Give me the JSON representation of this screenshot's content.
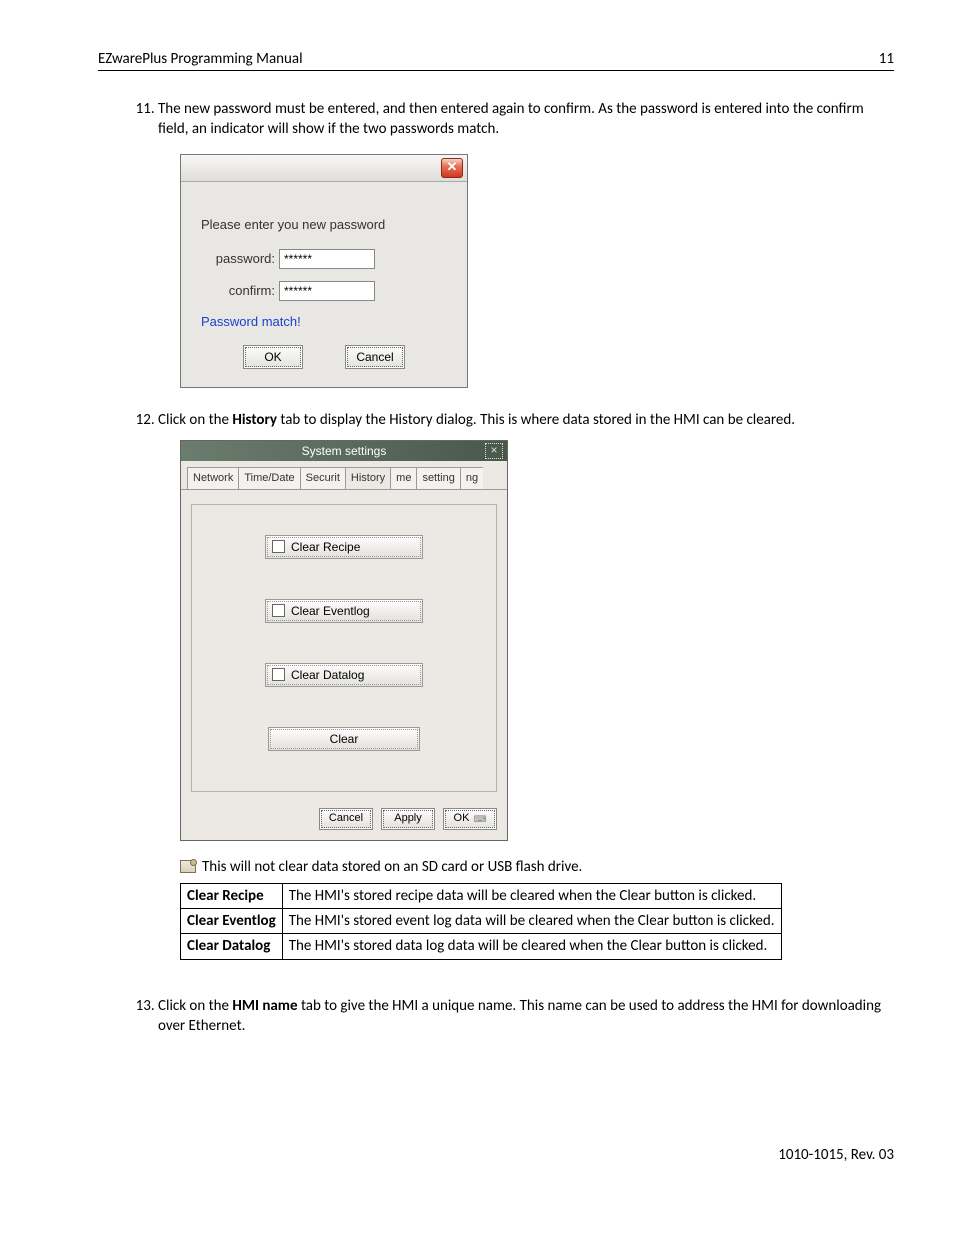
{
  "header": {
    "title": "EZwarePlus Programming Manual",
    "page": "11"
  },
  "item11": {
    "num": "11.",
    "text": "The new password must be entered, and then entered again to confirm. As the password is entered into the confirm field, an indicator will show if the two passwords match."
  },
  "pwdialog": {
    "prompt": "Please enter you new password",
    "password_label": "password:",
    "password_value": "******",
    "confirm_label": "confirm:",
    "confirm_value": "******",
    "match_text": "Password match!",
    "ok": "OK",
    "cancel": "Cancel"
  },
  "item12": {
    "num": "12.",
    "pre": "Click on the ",
    "bold": "History",
    "post": " tab to display the History dialog. This is where data stored in the HMI can be cleared."
  },
  "sysdialog": {
    "title": "System settings",
    "tabs": [
      "Network",
      "Time/Date",
      "Securit",
      "History",
      "me",
      "setting",
      "ng"
    ],
    "active_tab_index": 3,
    "checks": [
      "Clear Recipe",
      "Clear Eventlog",
      "Clear Datalog"
    ],
    "clear": "Clear",
    "cancel": "Cancel",
    "apply": "Apply",
    "ok": "OK"
  },
  "note": "This will not clear data stored on an SD card or USB flash drive.",
  "table": {
    "rows": [
      {
        "k": "Clear Recipe",
        "v": "The HMI's stored recipe data will be cleared when the Clear button is clicked."
      },
      {
        "k": "Clear Eventlog",
        "v": "The HMI's stored event log data will be cleared when the Clear button is clicked."
      },
      {
        "k": "Clear Datalog",
        "v": "The HMI's stored data log data will be cleared when the Clear button is clicked."
      }
    ]
  },
  "item13": {
    "num": "13.",
    "pre": "Click on the ",
    "bold": "HMI name",
    "post": " tab to give the HMI a unique name. This name can be used to address the HMI for downloading over Ethernet."
  },
  "footer": "1010-1015, Rev. 03"
}
